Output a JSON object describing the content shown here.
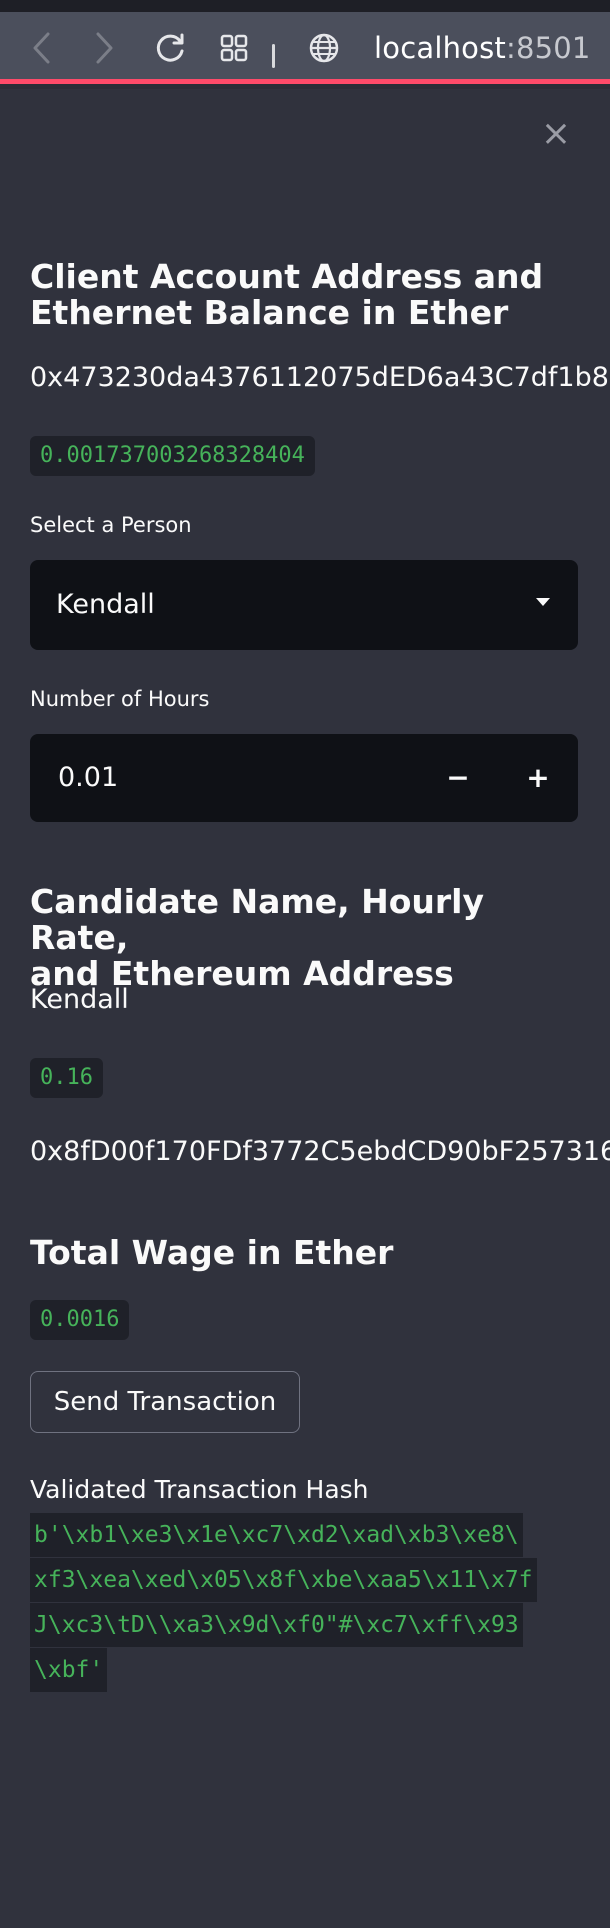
{
  "browser": {
    "url_host": "localhost",
    "url_port": ":8501",
    "accent_color": "#ff4b6a"
  },
  "sidebar": {
    "close_icon": "×",
    "section1": {
      "title_line1": "Client Account Address and",
      "title_line2": "Ethernet Balance in Ether",
      "address": "0x473230da4376112075dED6a43C7df1b8",
      "balance": "0.001737003268328404"
    },
    "select_person": {
      "label": "Select a Person",
      "value": "Kendall"
    },
    "hours": {
      "label": "Number of Hours",
      "value": "0.01",
      "minus": "−",
      "plus": "+"
    },
    "section2": {
      "title_line1": "Candidate Name, Hourly Rate,",
      "title_line2": "and Ethereum Address",
      "name": "Kendall",
      "rate": "0.16",
      "address": "0x8fD00f170FDf3772C5ebdCD90bF257316"
    },
    "section3": {
      "title": "Total Wage in Ether",
      "wage": "0.0016"
    },
    "send_button": "Send Transaction",
    "hash": {
      "label": "Validated Transaction Hash",
      "lines": [
        " b'\\xb1\\xe3\\x1e\\xc7\\xd2\\xad\\xb3\\xe8\\",
        "xf3\\xea\\xed\\x05\\x8f\\xbe\\xaa5\\x11\\x7f",
        "J\\xc3\\tD\\\\xa3\\x9d\\xf0\"#\\xc7\\xff\\x93",
        "\\xbf'"
      ]
    }
  }
}
